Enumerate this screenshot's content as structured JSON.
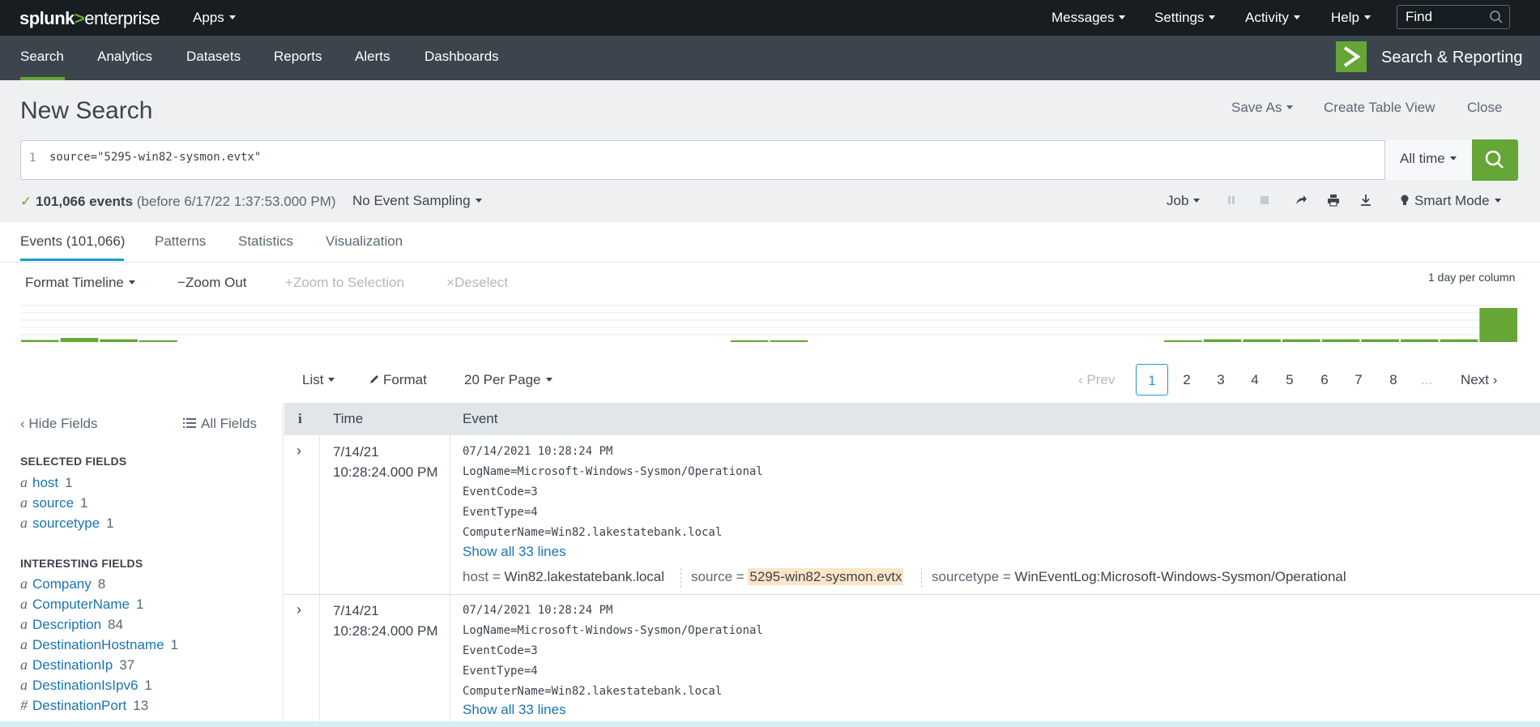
{
  "topbar": {
    "logo": {
      "a": "splunk",
      "b": ">",
      "c": "enterprise"
    },
    "apps": "Apps",
    "messages": "Messages",
    "settings": "Settings",
    "activity": "Activity",
    "help": "Help",
    "find_placeholder": "Find"
  },
  "appbar": {
    "nav": [
      "Search",
      "Analytics",
      "Datasets",
      "Reports",
      "Alerts",
      "Dashboards"
    ],
    "app_title": "Search & Reporting"
  },
  "header": {
    "title": "New Search",
    "save_as": "Save As",
    "create_table_view": "Create Table View",
    "close": "Close"
  },
  "search": {
    "line_number": "1",
    "query": "source=\"5295-win82-sysmon.evtx\"",
    "time_range": "All time"
  },
  "status": {
    "check": "✓",
    "events": "101,066 events",
    "before": "(before 6/17/22 1:37:53.000 PM)",
    "sampling": "No Event Sampling",
    "job": "Job",
    "mode": "Smart Mode"
  },
  "tabs": [
    "Events (101,066)",
    "Patterns",
    "Statistics",
    "Visualization"
  ],
  "timeline": {
    "format": "Format Timeline",
    "zoom_out": "Zoom Out",
    "zoom_to_selection": "Zoom to Selection",
    "deselect": "Deselect",
    "scale": "1 day per column",
    "bars": [
      0.06,
      0.12,
      0.08,
      0.05,
      0,
      0,
      0,
      0,
      0,
      0,
      0,
      0,
      0,
      0,
      0,
      0,
      0,
      0,
      0.05,
      0.05,
      0,
      0,
      0,
      0,
      0,
      0,
      0,
      0,
      0,
      0.05,
      0.08,
      0.08,
      0.08,
      0.08,
      0.08,
      0.08,
      0.08,
      1.0
    ],
    "colors": {
      "bar": "#65a637",
      "grid": "#e6e9ec"
    }
  },
  "results": {
    "list": "List",
    "format": "Format",
    "per_page": "20 Per Page",
    "prev": "Prev",
    "pages": [
      "1",
      "2",
      "3",
      "4",
      "5",
      "6",
      "7",
      "8"
    ],
    "ellipsis": "...",
    "next": "Next"
  },
  "sidebar": {
    "hide_fields": "Hide Fields",
    "all_fields": "All Fields",
    "selected_heading": "SELECTED FIELDS",
    "selected": [
      {
        "type": "a",
        "name": "host",
        "count": "1"
      },
      {
        "type": "a",
        "name": "source",
        "count": "1"
      },
      {
        "type": "a",
        "name": "sourcetype",
        "count": "1"
      }
    ],
    "interesting_heading": "INTERESTING FIELDS",
    "interesting": [
      {
        "type": "a",
        "name": "Company",
        "count": "8"
      },
      {
        "type": "a",
        "name": "ComputerName",
        "count": "1"
      },
      {
        "type": "a",
        "name": "Description",
        "count": "84"
      },
      {
        "type": "a",
        "name": "DestinationHostname",
        "count": "1"
      },
      {
        "type": "a",
        "name": "DestinationIp",
        "count": "37"
      },
      {
        "type": "a",
        "name": "DestinationIsIpv6",
        "count": "1"
      },
      {
        "type": "#",
        "name": "DestinationPort",
        "count": "13"
      }
    ]
  },
  "table": {
    "col_info": "i",
    "col_time": "Time",
    "col_event": "Event",
    "events": [
      {
        "date": "7/14/21",
        "time": "10:28:24.000 PM",
        "lines": [
          "07/14/2021 10:28:24 PM",
          "LogName=Microsoft-Windows-Sysmon/Operational",
          "EventCode=3",
          "EventType=4",
          "ComputerName=Win82.lakestatebank.local"
        ],
        "show_all": "Show all 33 lines",
        "meta": {
          "host_key": "host =",
          "host": "Win82.lakestatebank.local",
          "source_key": "source =",
          "source": "5295-win82-sysmon.evtx",
          "sourcetype_key": "sourcetype =",
          "sourcetype": "WinEventLog:Microsoft-Windows-Sysmon/Operational"
        }
      },
      {
        "date": "7/14/21",
        "time": "10:28:24.000 PM",
        "lines": [
          "07/14/2021 10:28:24 PM",
          "LogName=Microsoft-Windows-Sysmon/Operational",
          "EventCode=3",
          "EventType=4",
          "ComputerName=Win82.lakestatebank.local"
        ],
        "show_all": "Show all 33 lines"
      }
    ]
  },
  "colors": {
    "accent": "#65a637",
    "link": "#1a73b5",
    "topbar": "#171d21",
    "appbar": "#3c444d"
  }
}
